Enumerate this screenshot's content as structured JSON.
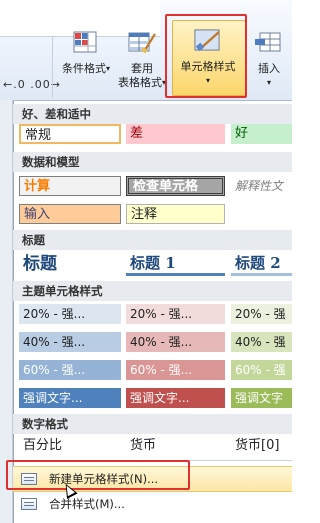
{
  "ribbon": {
    "number_format_symbols": ".00  .00",
    "buttons": {
      "conditional_format": "条件格式",
      "table_format_line1": "套用",
      "table_format_line2": "表格格式",
      "cell_styles": "单元格样式",
      "insert": "插入"
    }
  },
  "sections": {
    "good_bad_neutral": "好、差和适中",
    "data_model": "数据和模型",
    "titles": "标题",
    "theme_styles": "主题单元格样式",
    "number_format": "数字格式"
  },
  "good_bad_neutral": [
    "常规",
    "差",
    "好"
  ],
  "data_model_row1": [
    "计算",
    "检查单元格",
    "解释性文"
  ],
  "data_model_row2": [
    "输入",
    "注释"
  ],
  "titles": [
    "标题",
    "标题 1",
    "标题 2"
  ],
  "theme_rows": [
    [
      "20% - 强...",
      "20% - 强...",
      "20% - 强"
    ],
    [
      "40% - 强...",
      "40% - 强...",
      "40% - 强"
    ],
    [
      "60% - 强...",
      "60% - 强...",
      "60% - 强"
    ],
    [
      "强调文字...",
      "强调文字...",
      "强调文字"
    ]
  ],
  "number_format": [
    "百分比",
    "货币",
    "货币[0]"
  ],
  "menu": {
    "new_style": "新建单元格样式(N)...",
    "merge_style": "合并样式(M)..."
  },
  "colors": {
    "highlight_red": "#e03030",
    "bad_bg": "#ffc7ce",
    "good_bg": "#c6efce",
    "calc_text": "#fa7d00",
    "check_bg": "#a5a5a5",
    "input_bg": "#ffcc99",
    "note_bg": "#ffffcc",
    "title_blue": "#1f497d",
    "accent1_dark": "#4f81bd",
    "accent2_dark": "#c0504d",
    "accent3_dark": "#9bbb59"
  }
}
